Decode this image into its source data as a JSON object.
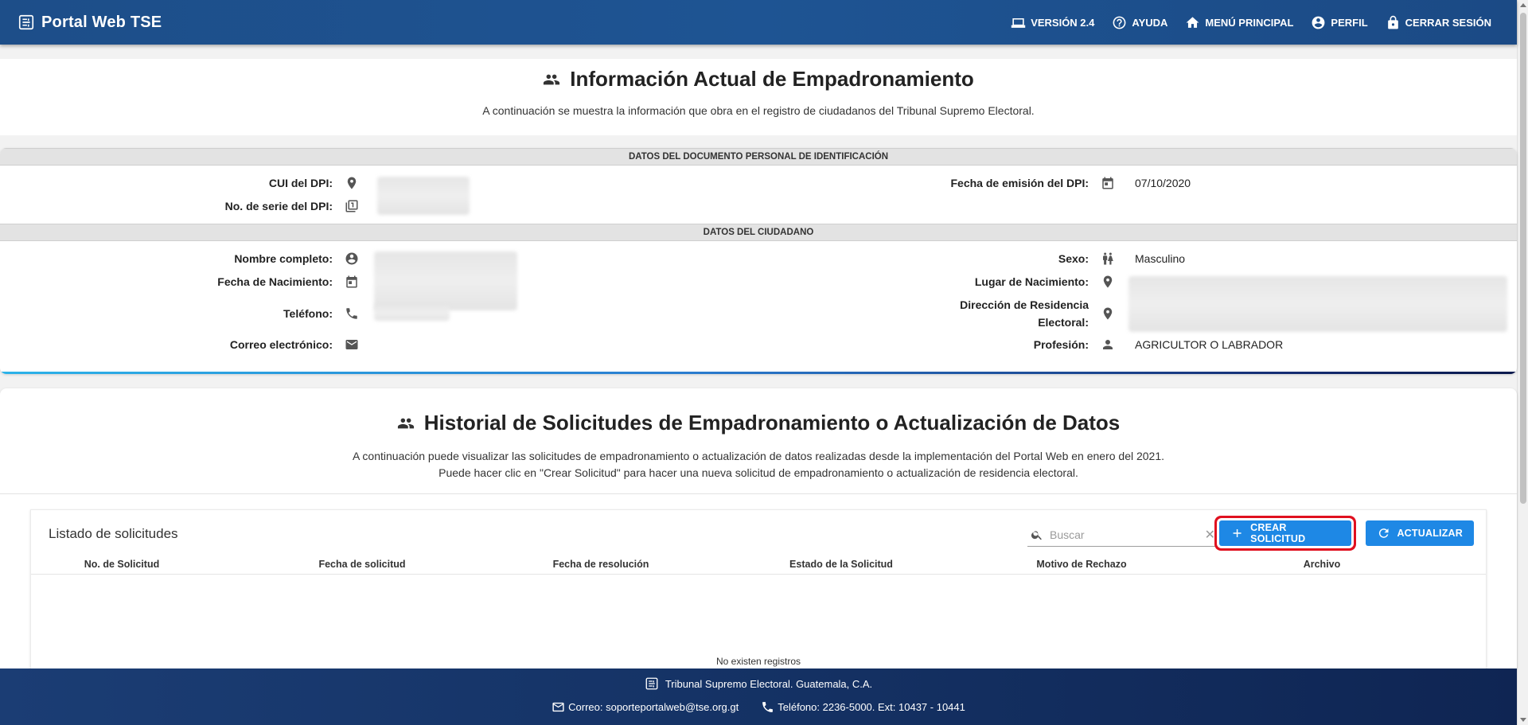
{
  "appbar": {
    "title": "Portal Web TSE",
    "nav": [
      {
        "icon": "laptop-icon",
        "label": "VERSIÓN 2.4"
      },
      {
        "icon": "help-icon",
        "label": "AYUDA"
      },
      {
        "icon": "home-icon",
        "label": "MENÚ PRINCIPAL"
      },
      {
        "icon": "account-icon",
        "label": "PERFIL"
      },
      {
        "icon": "lock-icon",
        "label": "CERRAR SESIÓN"
      }
    ]
  },
  "info": {
    "title": "Información Actual de Empadronamiento",
    "subtitle": "A continuación se muestra la información que obra en el registro de ciudadanos del Tribunal Supremo Electoral.",
    "dpi_section": "DATOS DEL DOCUMENTO PERSONAL DE IDENTIFICACIÓN",
    "cui_label": "CUI del DPI:",
    "serie_label": "No. de serie del DPI:",
    "emision_label": "Fecha de emisión del DPI:",
    "emision_value": "07/10/2020",
    "ciudadano_section": "DATOS DEL CIUDADANO",
    "nombre_label": "Nombre completo:",
    "nacimiento_label": "Fecha de Nacimiento:",
    "telefono_label": "Teléfono:",
    "correo_label": "Correo electrónico:",
    "sexo_label": "Sexo:",
    "sexo_value": "Masculino",
    "lugar_label": "Lugar de Nacimiento:",
    "direccion_label_1": "Dirección de Residencia",
    "direccion_label_2": "Electoral:",
    "profesion_label": "Profesión:",
    "profesion_value": "AGRICULTOR O LABRADOR"
  },
  "historial": {
    "title": "Historial de Solicitudes de Empadronamiento o Actualización de Datos",
    "desc_1": "A continuación puede visualizar las solicitudes de empadronamiento o actualización de datos realizadas desde la implementación del Portal Web en enero del 2021.",
    "desc_2": "Puede hacer clic en \"Crear Solicitud\" para hacer una nueva solicitud de empadronamiento o actualización de residencia electoral.",
    "list_title": "Listado de solicitudes",
    "search_placeholder": "Buscar",
    "crear_label": "CREAR SOLICITUD",
    "actualizar_label": "ACTUALIZAR",
    "columns": [
      "No. de Solicitud",
      "Fecha de solicitud",
      "Fecha de resolución",
      "Estado de la Solicitud",
      "Motivo de Rechazo",
      "Archivo"
    ],
    "empty_text": "No existen registros"
  },
  "footer": {
    "org": "Tribunal Supremo Electoral. Guatemala, C.A.",
    "correo": "Correo: soporteportalweb@tse.org.gt",
    "telefono": "Teléfono: 2236-5000. Ext: 10437 - 10441"
  },
  "colors": {
    "appbar": "#1d4e89",
    "primary_button": "#1e88e5",
    "highlight_border": "#e0101f",
    "footer": "#153366"
  }
}
